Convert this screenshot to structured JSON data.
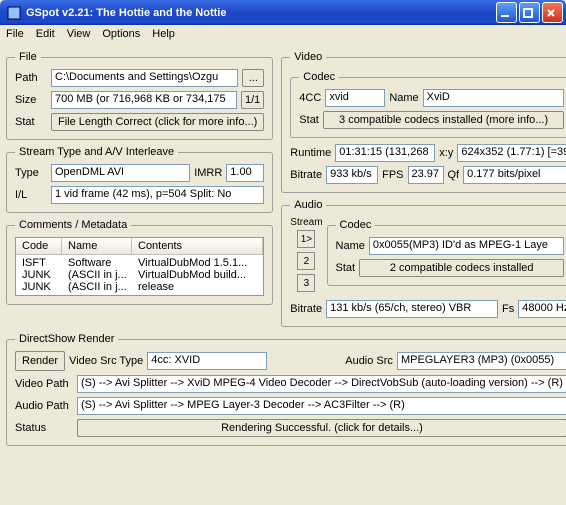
{
  "window": {
    "title": "GSpot v2.21: The Hottie and the Nottie"
  },
  "menu": {
    "file": "File",
    "edit": "Edit",
    "view": "View",
    "options": "Options",
    "help": "Help"
  },
  "file": {
    "legend": "File",
    "pathLabel": "Path",
    "pathValue": "C:\\Documents and Settings\\Ozgu",
    "browseBtn": "...",
    "sizeLabel": "Size",
    "sizeValue": "700 MB (or 716,968 KB or 734,175",
    "ratioBtn": "1/1",
    "statLabel": "Stat",
    "statBtn": "File Length Correct (click for more info...)"
  },
  "stream": {
    "legend": "Stream Type and A/V Interleave",
    "typeLabel": "Type",
    "typeValue": "OpenDML AVI",
    "imrrLabel": "IMRR",
    "imrrValue": "1.00",
    "ilLabel": "I/L",
    "ilValue": "1 vid frame (42 ms), p=504  Split: No"
  },
  "comments": {
    "legend": "Comments / Metadata",
    "hCode": "Code",
    "hName": "Name",
    "hContents": "Contents",
    "rows": [
      {
        "code": "ISFT",
        "name": "Software",
        "contents": "VirtualDubMod 1.5.1..."
      },
      {
        "code": "JUNK",
        "name": "(ASCII in j...",
        "contents": "VirtualDubMod build..."
      },
      {
        "code": "JUNK",
        "name": "(ASCII in j...",
        "contents": "release"
      }
    ]
  },
  "video": {
    "legend": "Video",
    "codecLegend": "Codec",
    "fccLabel": "4CC",
    "fccValue": "xvid",
    "nameLabel": "Name",
    "nameValue": "XviD",
    "statLabel": "Stat",
    "statBtn": "3 compatible codecs installed (more info...)",
    "runtimeLabel": "Runtime",
    "runtimeValue": "01:31:15 (131,268",
    "xyLabel": "x:y",
    "xyValue": "624x352 (1.77:1) [=39",
    "bitrateLabel": "Bitrate",
    "bitrateValue": "933 kb/s",
    "fpsLabel": "FPS",
    "fpsValue": "23.97",
    "qfLabel": "Qf",
    "qfValue": "0.177 bits/pixel"
  },
  "audio": {
    "legend": "Audio",
    "streamLabel": "Stream",
    "s1": "1>",
    "s2": "2",
    "s3": "3",
    "codecLegend": "Codec",
    "nameLabel": "Name",
    "nameValue": "0x0055(MP3) ID'd as MPEG-1 Laye",
    "statLabel": "Stat",
    "statBtn": "2 compatible codecs installed",
    "bitrateLabel": "Bitrate",
    "bitrateValue": "131 kb/s (65/ch, stereo) VBR",
    "fsLabel": "Fs",
    "fsValue": "48000 Hz"
  },
  "ds": {
    "legend": "DirectShow Render",
    "renderBtn": "Render",
    "vstLabel": "Video Src Type",
    "vstValue": "4cc: XVID",
    "asrcLabel": "Audio Src",
    "asrcValue": "MPEGLAYER3 (MP3) (0x0055)",
    "vpathLabel": "Video Path",
    "vpathValue": "(S) --> Avi Splitter --> XviD MPEG-4 Video Decoder --> DirectVobSub (auto-loading version) --> (R)",
    "apathLabel": "Audio Path",
    "apathValue": "(S) --> Avi Splitter --> MPEG Layer-3 Decoder --> AC3Filter --> (R)",
    "statusLabel": "Status",
    "statusBtn": "Rendering Successful.  (click for details...)"
  }
}
